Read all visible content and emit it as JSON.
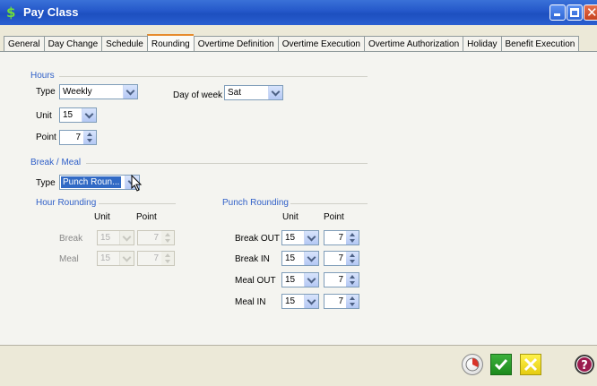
{
  "window": {
    "title": "Pay Class",
    "app_icon": "dollar-icon"
  },
  "tabs": [
    {
      "label": "General"
    },
    {
      "label": "Day Change"
    },
    {
      "label": "Schedule"
    },
    {
      "label": "Rounding",
      "active": true
    },
    {
      "label": "Overtime Definition"
    },
    {
      "label": "Overtime Execution"
    },
    {
      "label": "Overtime Authorization"
    },
    {
      "label": "Holiday"
    },
    {
      "label": "Benefit Execution"
    }
  ],
  "hours": {
    "section": "Hours",
    "type_label": "Type",
    "type_value": "Weekly",
    "day_of_week_label": "Day of week",
    "day_of_week_value": "Sat",
    "unit_label": "Unit",
    "unit_value": "15",
    "point_label": "Point",
    "point_value": "7"
  },
  "break_meal": {
    "section": "Break / Meal",
    "type_label": "Type",
    "type_value": "Punch Roun..."
  },
  "hour_rounding": {
    "section": "Hour Rounding",
    "unit_header": "Unit",
    "point_header": "Point",
    "rows": [
      {
        "label": "Break",
        "unit": "15",
        "point": "7"
      },
      {
        "label": "Meal",
        "unit": "15",
        "point": "7"
      }
    ]
  },
  "punch_rounding": {
    "section": "Punch Rounding",
    "unit_header": "Unit",
    "point_header": "Point",
    "rows": [
      {
        "label": "Break OUT",
        "unit": "15",
        "point": "7"
      },
      {
        "label": "Break IN",
        "unit": "15",
        "point": "7"
      },
      {
        "label": "Meal OUT",
        "unit": "15",
        "point": "7"
      },
      {
        "label": "Meal IN",
        "unit": "15",
        "point": "7"
      }
    ]
  },
  "buttons": {
    "refresh": "refresh-icon",
    "ok": "checkmark-icon",
    "cancel": "cancel-x-icon",
    "help": "help-icon"
  },
  "colors": {
    "title_bar": "#2457c9",
    "section_title": "#3060c8",
    "active_tab_accent": "#e68b2c",
    "ok": "#1c8a1c",
    "cancel": "#e5cc10"
  }
}
